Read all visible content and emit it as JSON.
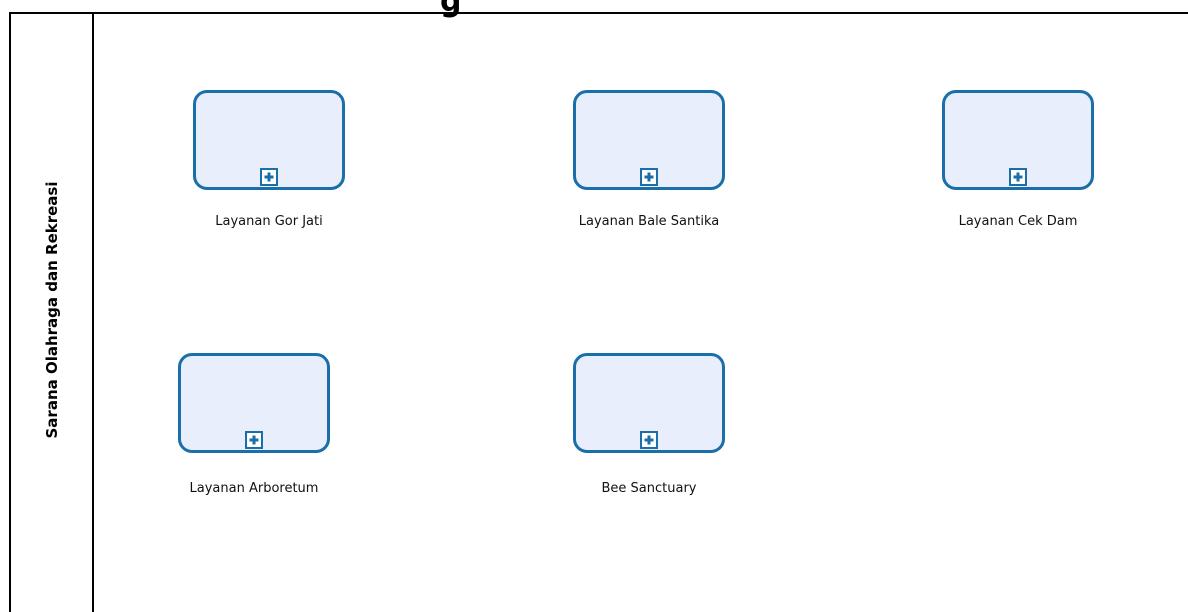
{
  "diagram": {
    "top_fragment": "g",
    "lane": {
      "title": "Sarana Olahraga dan Rekreasi"
    },
    "tasks": [
      {
        "label": "Layanan Gor Jati",
        "marker": "collapsed-subprocess-plus-icon"
      },
      {
        "label": "Layanan Bale Santika",
        "marker": "collapsed-subprocess-plus-icon"
      },
      {
        "label": "Layanan Cek Dam",
        "marker": "collapsed-subprocess-plus-icon"
      },
      {
        "label": "Layanan Arboretum",
        "marker": "collapsed-subprocess-plus-icon"
      },
      {
        "label": "Bee Sanctuary",
        "marker": "collapsed-subprocess-plus-icon"
      }
    ],
    "colors": {
      "task_border": "#1a6fa8",
      "task_fill": "#e8eefc",
      "lines": "#000000"
    }
  }
}
